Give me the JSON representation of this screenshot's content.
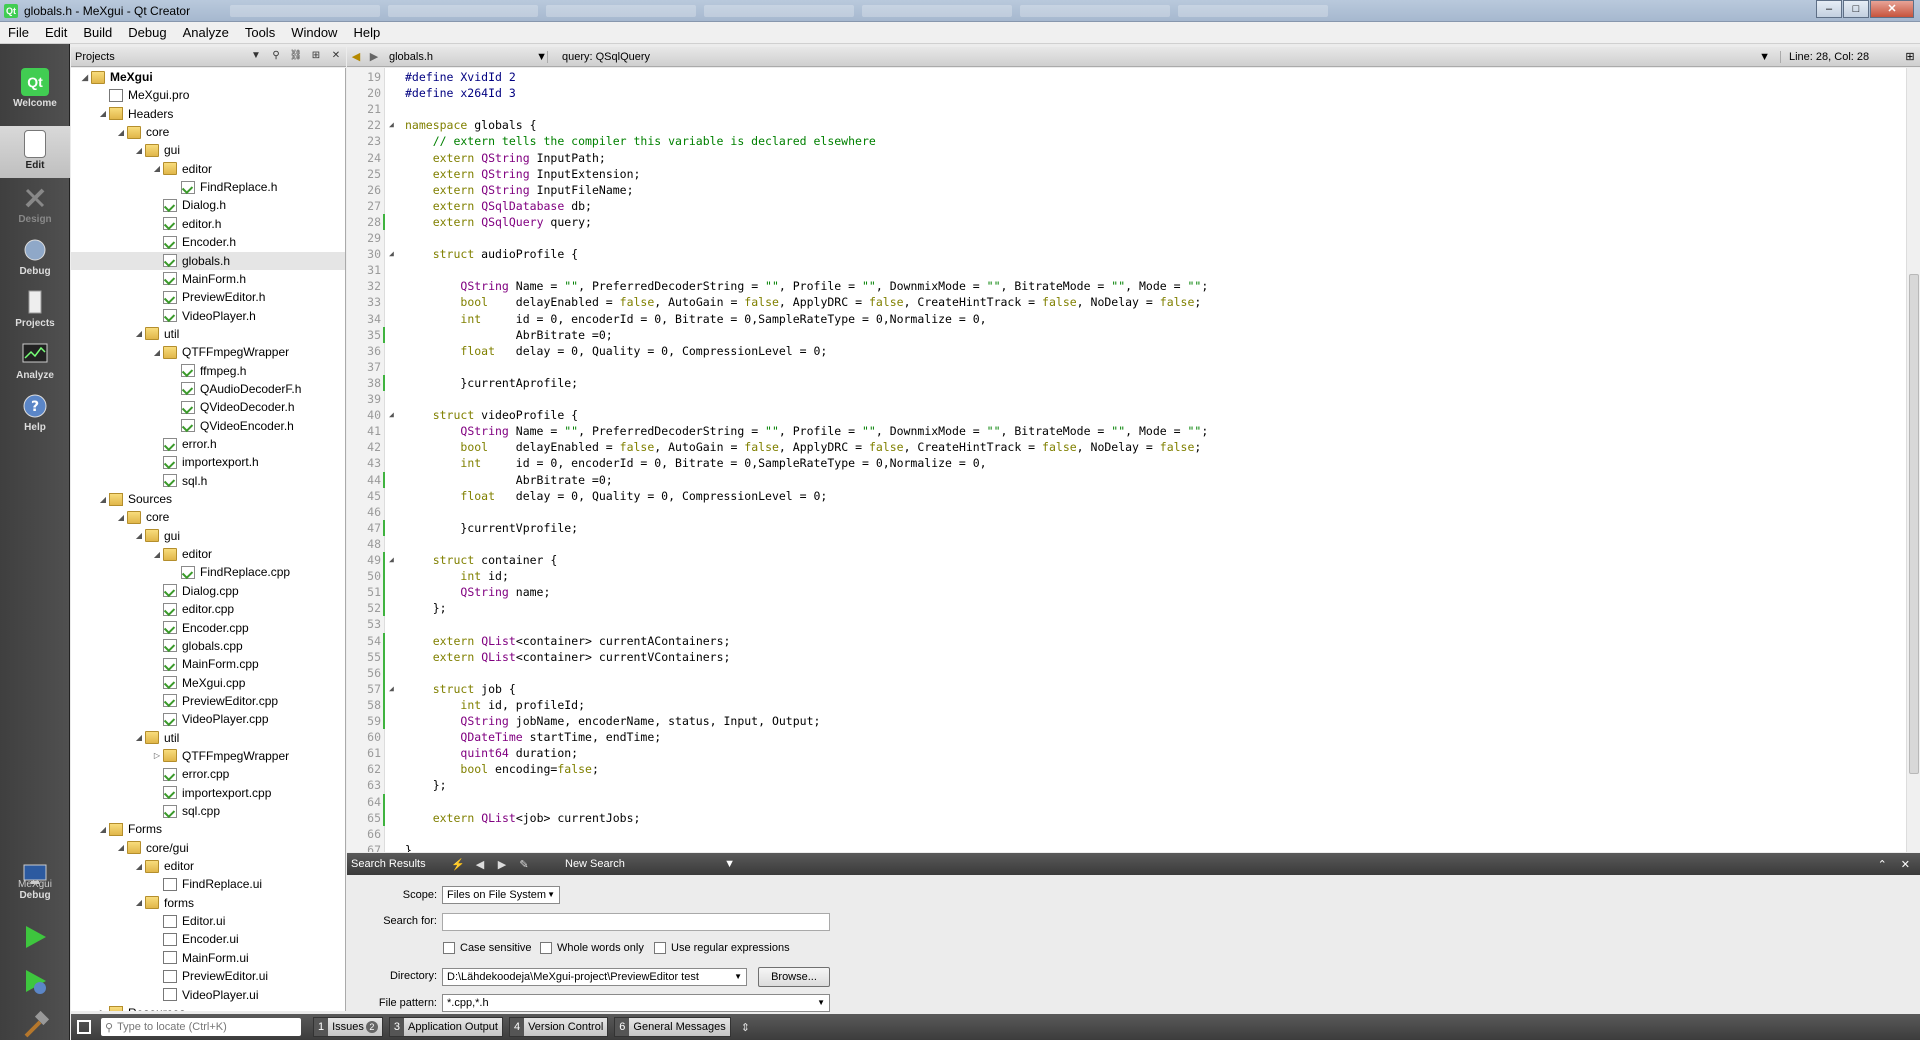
{
  "window": {
    "title": "globals.h - MeXgui - Qt Creator",
    "app_icon": "Qt",
    "minimize": "–",
    "maximize": "□",
    "close": "✕"
  },
  "menu": [
    "File",
    "Edit",
    "Build",
    "Debug",
    "Analyze",
    "Tools",
    "Window",
    "Help"
  ],
  "modes": [
    {
      "label": "Welcome",
      "icon": "qt-logo-icon"
    },
    {
      "label": "Edit",
      "icon": "edit-document-icon"
    },
    {
      "label": "Design",
      "icon": "design-pen-icon"
    },
    {
      "label": "Debug",
      "icon": "debug-bug-icon"
    },
    {
      "label": "Projects",
      "icon": "projects-wrench-icon"
    },
    {
      "label": "Analyze",
      "icon": "analyze-monitor-icon"
    },
    {
      "label": "Help",
      "icon": "help-question-icon"
    }
  ],
  "kit": {
    "project": "MeXgui",
    "build": "Debug"
  },
  "projects_pane": {
    "title": "Projects",
    "tree": [
      {
        "label": "MeXgui",
        "level": 0,
        "icon": "project",
        "expanded": true,
        "bold": true
      },
      {
        "label": "MeXgui.pro",
        "level": 1,
        "icon": "pro"
      },
      {
        "label": "Headers",
        "level": 1,
        "icon": "hfolder",
        "expanded": true
      },
      {
        "label": "core",
        "level": 2,
        "icon": "folder",
        "expanded": true
      },
      {
        "label": "gui",
        "level": 3,
        "icon": "folder",
        "expanded": true
      },
      {
        "label": "editor",
        "level": 4,
        "icon": "folder",
        "expanded": true
      },
      {
        "label": "FindReplace.h",
        "level": 5,
        "icon": "file"
      },
      {
        "label": "Dialog.h",
        "level": 4,
        "icon": "file"
      },
      {
        "label": "editor.h",
        "level": 4,
        "icon": "file"
      },
      {
        "label": "Encoder.h",
        "level": 4,
        "icon": "file"
      },
      {
        "label": "globals.h",
        "level": 4,
        "icon": "file",
        "selected": true
      },
      {
        "label": "MainForm.h",
        "level": 4,
        "icon": "file"
      },
      {
        "label": "PreviewEditor.h",
        "level": 4,
        "icon": "file"
      },
      {
        "label": "VideoPlayer.h",
        "level": 4,
        "icon": "file"
      },
      {
        "label": "util",
        "level": 3,
        "icon": "folder",
        "expanded": true
      },
      {
        "label": "QTFFmpegWrapper",
        "level": 4,
        "icon": "folder",
        "expanded": true
      },
      {
        "label": "ffmpeg.h",
        "level": 5,
        "icon": "file"
      },
      {
        "label": "QAudioDecoderF.h",
        "level": 5,
        "icon": "file"
      },
      {
        "label": "QVideoDecoder.h",
        "level": 5,
        "icon": "file"
      },
      {
        "label": "QVideoEncoder.h",
        "level": 5,
        "icon": "file"
      },
      {
        "label": "error.h",
        "level": 4,
        "icon": "file"
      },
      {
        "label": "importexport.h",
        "level": 4,
        "icon": "file"
      },
      {
        "label": "sql.h",
        "level": 4,
        "icon": "file"
      },
      {
        "label": "Sources",
        "level": 1,
        "icon": "hfolder",
        "expanded": true
      },
      {
        "label": "core",
        "level": 2,
        "icon": "folder",
        "expanded": true
      },
      {
        "label": "gui",
        "level": 3,
        "icon": "folder",
        "expanded": true
      },
      {
        "label": "editor",
        "level": 4,
        "icon": "folder",
        "expanded": true
      },
      {
        "label": "FindReplace.cpp",
        "level": 5,
        "icon": "file"
      },
      {
        "label": "Dialog.cpp",
        "level": 4,
        "icon": "file"
      },
      {
        "label": "editor.cpp",
        "level": 4,
        "icon": "file"
      },
      {
        "label": "Encoder.cpp",
        "level": 4,
        "icon": "file"
      },
      {
        "label": "globals.cpp",
        "level": 4,
        "icon": "file"
      },
      {
        "label": "MainForm.cpp",
        "level": 4,
        "icon": "file"
      },
      {
        "label": "MeXgui.cpp",
        "level": 4,
        "icon": "file"
      },
      {
        "label": "PreviewEditor.cpp",
        "level": 4,
        "icon": "file"
      },
      {
        "label": "VideoPlayer.cpp",
        "level": 4,
        "icon": "file"
      },
      {
        "label": "util",
        "level": 3,
        "icon": "folder",
        "expanded": true
      },
      {
        "label": "QTFFmpegWrapper",
        "level": 4,
        "icon": "folder",
        "expanded": false
      },
      {
        "label": "error.cpp",
        "level": 4,
        "icon": "file"
      },
      {
        "label": "importexport.cpp",
        "level": 4,
        "icon": "file"
      },
      {
        "label": "sql.cpp",
        "level": 4,
        "icon": "file"
      },
      {
        "label": "Forms",
        "level": 1,
        "icon": "hfolder",
        "expanded": true
      },
      {
        "label": "core/gui",
        "level": 2,
        "icon": "folder",
        "expanded": true
      },
      {
        "label": "editor",
        "level": 3,
        "icon": "folder",
        "expanded": true
      },
      {
        "label": "FindReplace.ui",
        "level": 4,
        "icon": "ui"
      },
      {
        "label": "forms",
        "level": 3,
        "icon": "folder",
        "expanded": true
      },
      {
        "label": "Editor.ui",
        "level": 4,
        "icon": "ui"
      },
      {
        "label": "Encoder.ui",
        "level": 4,
        "icon": "ui"
      },
      {
        "label": "MainForm.ui",
        "level": 4,
        "icon": "ui"
      },
      {
        "label": "PreviewEditor.ui",
        "level": 4,
        "icon": "ui"
      },
      {
        "label": "VideoPlayer.ui",
        "level": 4,
        "icon": "ui"
      },
      {
        "label": "Resources",
        "level": 1,
        "icon": "hfolder",
        "expanded": false
      }
    ]
  },
  "editor_toolbar": {
    "document": "globals.h",
    "symbol": "query: QSqlQuery",
    "position": "Line: 28, Col: 28"
  },
  "code": [
    {
      "n": "19",
      "t": "#define XvidId 2"
    },
    {
      "n": "20",
      "t": "#define x264Id 3"
    },
    {
      "n": "21",
      "t": ""
    },
    {
      "n": "22",
      "t": "namespace globals {",
      "fold": true
    },
    {
      "n": "23",
      "t": "    // extern tells the compiler this variable is declared elsewhere"
    },
    {
      "n": "24",
      "t": "    extern QString InputPath;"
    },
    {
      "n": "25",
      "t": "    extern QString InputExtension;"
    },
    {
      "n": "26",
      "t": "    extern QString InputFileName;"
    },
    {
      "n": "27",
      "t": "    extern QSqlDatabase db;"
    },
    {
      "n": "28",
      "t": "    extern QSqlQuery query;",
      "changed": true
    },
    {
      "n": "29",
      "t": ""
    },
    {
      "n": "30",
      "t": "    struct audioProfile {",
      "fold": true
    },
    {
      "n": "31",
      "t": ""
    },
    {
      "n": "32",
      "t": "        QString Name = \"\", PreferredDecoderString = \"\", Profile = \"\", DownmixMode = \"\", BitrateMode = \"\", Mode = \"\";"
    },
    {
      "n": "33",
      "t": "        bool    delayEnabled = false, AutoGain = false, ApplyDRC = false, CreateHintTrack = false, NoDelay = false;"
    },
    {
      "n": "34",
      "t": "        int     id = 0, encoderId = 0, Bitrate = 0,SampleRateType = 0,Normalize = 0,"
    },
    {
      "n": "35",
      "t": "                AbrBitrate =0;",
      "changed": true
    },
    {
      "n": "36",
      "t": "        float   delay = 0, Quality = 0, CompressionLevel = 0;"
    },
    {
      "n": "37",
      "t": ""
    },
    {
      "n": "38",
      "t": "        }currentAprofile;",
      "changed": true
    },
    {
      "n": "39",
      "t": ""
    },
    {
      "n": "40",
      "t": "    struct videoProfile {",
      "fold": true
    },
    {
      "n": "41",
      "t": "        QString Name = \"\", PreferredDecoderString = \"\", Profile = \"\", DownmixMode = \"\", BitrateMode = \"\", Mode = \"\";"
    },
    {
      "n": "42",
      "t": "        bool    delayEnabled = false, AutoGain = false, ApplyDRC = false, CreateHintTrack = false, NoDelay = false;"
    },
    {
      "n": "43",
      "t": "        int     id = 0, encoderId = 0, Bitrate = 0,SampleRateType = 0,Normalize = 0,"
    },
    {
      "n": "44",
      "t": "                AbrBitrate =0;",
      "changed": true
    },
    {
      "n": "45",
      "t": "        float   delay = 0, Quality = 0, CompressionLevel = 0;"
    },
    {
      "n": "46",
      "t": ""
    },
    {
      "n": "47",
      "t": "        }currentVprofile;",
      "changed": true
    },
    {
      "n": "48",
      "t": ""
    },
    {
      "n": "49",
      "t": "    struct container {",
      "fold": true,
      "changed": true
    },
    {
      "n": "50",
      "t": "        int id;",
      "changed": true
    },
    {
      "n": "51",
      "t": "        QString name;",
      "changed": true
    },
    {
      "n": "52",
      "t": "    };",
      "changed": true
    },
    {
      "n": "53",
      "t": ""
    },
    {
      "n": "54",
      "t": "    extern QList<container> currentAContainers;",
      "changed": true
    },
    {
      "n": "55",
      "t": "    extern QList<container> currentVContainers;",
      "changed": true
    },
    {
      "n": "56",
      "t": "",
      "changed": true
    },
    {
      "n": "57",
      "t": "    struct job {",
      "fold": true,
      "changed": true
    },
    {
      "n": "58",
      "t": "        int id, profileId;",
      "changed": true
    },
    {
      "n": "59",
      "t": "        QString jobName, encoderName, status, Input, Output;",
      "changed": true
    },
    {
      "n": "60",
      "t": "        QDateTime startTime, endTime;"
    },
    {
      "n": "61",
      "t": "        quint64 duration;"
    },
    {
      "n": "62",
      "t": "        bool encoding=false;"
    },
    {
      "n": "63",
      "t": "    };"
    },
    {
      "n": "64",
      "t": "",
      "changed": true
    },
    {
      "n": "65",
      "t": "    extern QList<job> currentJobs;",
      "changed": true
    },
    {
      "n": "66",
      "t": ""
    },
    {
      "n": "67",
      "t": "}"
    }
  ],
  "search_results": {
    "title": "Search Results",
    "new_search": "New Search",
    "scope_label": "Scope:",
    "scope_value": "Files on File System",
    "search_for_label": "Search for:",
    "search_for_value": "",
    "case_sensitive": "Case sensitive",
    "whole_words": "Whole words only",
    "regex": "Use regular expressions",
    "directory_label": "Directory:",
    "directory_value": "D:\\Lähdekoodeja\\MeXgui-project\\PreviewEditor test",
    "browse": "Browse...",
    "file_pattern_label": "File pattern:",
    "file_pattern_value": "*.cpp,*.h"
  },
  "statusbar": {
    "locator_placeholder": "Type to locate (Ctrl+K)",
    "tabs": [
      {
        "num": "1",
        "label": "Issues",
        "badge": "2"
      },
      {
        "num": "3",
        "label": "Application Output"
      },
      {
        "num": "4",
        "label": "Version Control"
      },
      {
        "num": "6",
        "label": "General Messages"
      }
    ]
  },
  "colors": {
    "keyword": "#808000",
    "type": "#800080",
    "string": "#008000",
    "comment": "#008000",
    "preprocessor": "#000080",
    "change_marker": "#3fb33f"
  }
}
